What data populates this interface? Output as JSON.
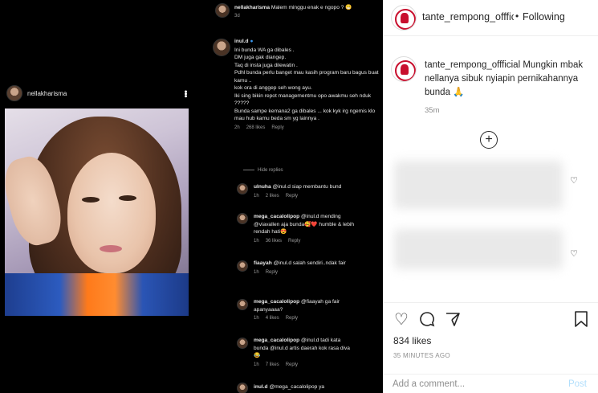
{
  "left_post": {
    "username": "nellakharisma"
  },
  "comments": [
    {
      "user": "nellakharisma",
      "text": "Malem minggu enak e ngopo ? 😁",
      "time": "3d"
    },
    {
      "user": "inul.d",
      "text": "Ini bunda WA ga dibales .\nDM juga gak diangep.\nTaq di insta juga dilewatin .\nPdhl bunda perlu banget mau kasih program baru bagus buat kamu ..\nkok ora di anggep seh wong ayu.\nIki sing bikin repot managementmu opo awakmu seh nduk ?????\nBunda sampe kemana2 ga dibales ... kok kyk irg ngemis klo mau hub kamu beda sm yg lainnya .",
      "time": "2h",
      "likes": "268 likes",
      "reply": "Reply"
    },
    {
      "user": "ulnuha",
      "text": "@inul.d siap membantu bund",
      "time": "1h",
      "likes": "2 likes",
      "reply": "Reply"
    },
    {
      "user": "mega_cacalolipop",
      "text": "@inul.d mending @viavallen aja bunda🥰❤️ humble & lebih rendah hati😍",
      "time": "1h",
      "likes": "36 likes",
      "reply": "Reply"
    },
    {
      "user": "fiaayah",
      "text": "@inul.d salah sendiri..ndak fair",
      "time": "1h",
      "reply": "Reply"
    },
    {
      "user": "mega_cacalolipop",
      "text": "@fiaayah ga fair apanyaaaa?",
      "time": "1h",
      "likes": "4 likes",
      "reply": "Reply"
    },
    {
      "user": "mega_cacalolipop",
      "text": "@inul.d tadi kata bunda @inul.d artis daerah kok rasa diva😂",
      "time": "1h",
      "likes": "7 likes",
      "reply": "Reply"
    },
    {
      "user": "inul.d",
      "text": "@mega_cacalolipop ya"
    }
  ],
  "hide_replies": "Hide replies",
  "right": {
    "account": "tante_rempong_offficial",
    "dot": "•",
    "following": "Following",
    "caption_user": "tante_rempong_offficial",
    "caption_text": "Mungkin mbak nellanya sibuk nyiapin pernikahannya bunda 🙏",
    "caption_time": "35m",
    "likes": "834 likes",
    "posted_ago": "35 MINUTES AGO",
    "comment_placeholder": "Add a comment...",
    "post_label": "Post"
  },
  "icons": [
    "heart-icon",
    "comment-icon",
    "share-icon",
    "bookmark-icon",
    "more-icon",
    "plus-circle-icon",
    "verified-icon"
  ]
}
